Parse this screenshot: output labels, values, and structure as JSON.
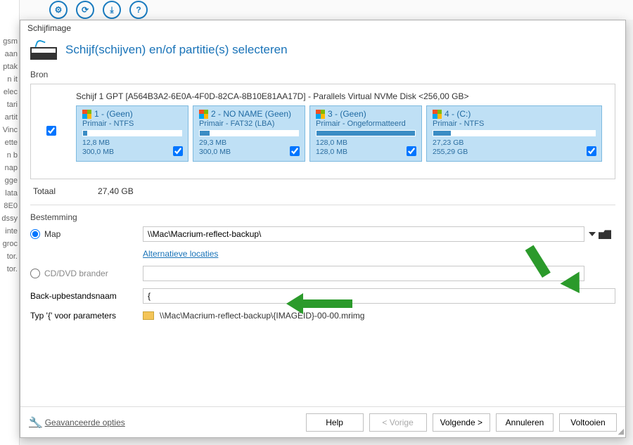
{
  "background": {
    "fragments": [
      "gsm",
      "aan",
      "ptak",
      "n it",
      "elec",
      "tari",
      "artit",
      "Vinc",
      "ette",
      "n b",
      "nap",
      "gge",
      "lata",
      "8E0",
      "dssy",
      "inte",
      "groc",
      "tor.",
      "tor."
    ]
  },
  "dialog": {
    "title": "Schijfimage",
    "heading": "Schijf(schijven) en/of partitie(s) selecteren"
  },
  "source": {
    "label": "Bron",
    "disk_title": "Schijf 1 GPT [A564B3A2-6E0A-4F0D-82CA-8B10E81AA17D] - Parallels Virtual NVMe Disk  <256,00 GB>",
    "master_checked": true,
    "partitions": [
      {
        "name": "1 -  (Geen)",
        "sub": "Primair - NTFS",
        "usedpct": 4,
        "used": "12,8 MB",
        "total": "300,0 MB",
        "checked": true
      },
      {
        "name": "2 - NO NAME (Geen)",
        "sub": "Primair - FAT32 (LBA)",
        "usedpct": 10,
        "used": "29,3 MB",
        "total": "300,0 MB",
        "checked": true
      },
      {
        "name": "3 -  (Geen)",
        "sub": "Primair - Ongeformatteerd",
        "usedpct": 100,
        "used": "128,0 MB",
        "total": "128,0 MB",
        "checked": true
      },
      {
        "name": "4 -  (C:)",
        "sub": "Primair - NTFS",
        "usedpct": 11,
        "used": "27,23 GB",
        "total": "255,29 GB",
        "checked": true
      }
    ]
  },
  "total": {
    "label": "Totaal",
    "value": "27,40 GB"
  },
  "destination": {
    "label": "Bestemming",
    "map_label": "Map",
    "map_value": "\\\\Mac\\Macrium-reflect-backup\\",
    "alt_link": "Alternatieve locaties",
    "cd_label": "CD/DVD brander",
    "filename_label": "Back-upbestandsnaam",
    "filename_value": "{",
    "param_label": "Typ '{' voor parameters",
    "param_path": "\\\\Mac\\Macrium-reflect-backup\\{IMAGEID}-00-00.mrimg"
  },
  "footer": {
    "advanced": "Geavanceerde opties",
    "help": "Help",
    "prev": "< Vorige",
    "next": "Volgende >",
    "cancel": "Annuleren",
    "finish": "Voltooien"
  }
}
